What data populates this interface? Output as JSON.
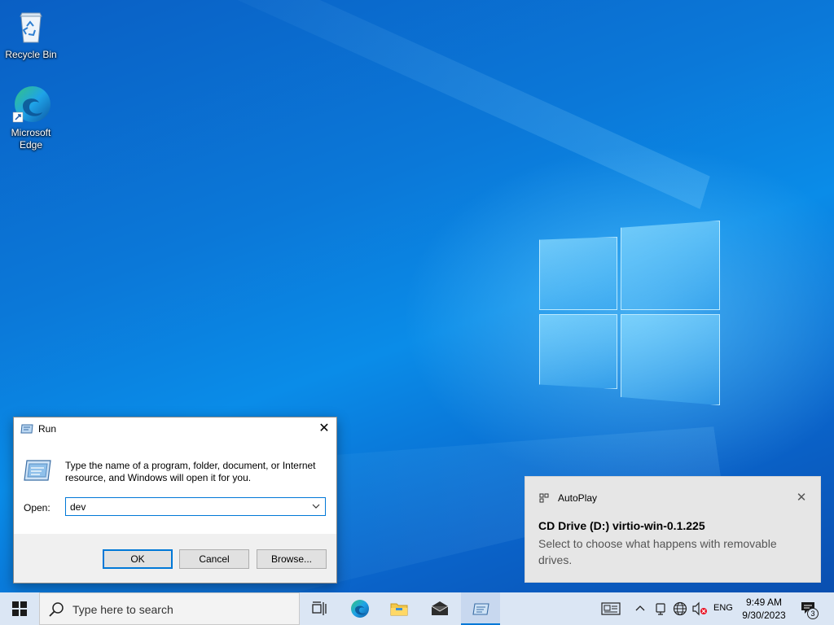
{
  "desktop": {
    "icons": [
      {
        "label": "Recycle Bin"
      },
      {
        "label": "Microsoft Edge"
      }
    ]
  },
  "run_dialog": {
    "title": "Run",
    "description": "Type the name of a program, folder, document, or Internet resource, and Windows will open it for you.",
    "open_label": "Open:",
    "input_value": "dev",
    "ok_label": "OK",
    "cancel_label": "Cancel",
    "browse_label": "Browse..."
  },
  "toast": {
    "app_name": "AutoPlay",
    "title": "CD Drive (D:) virtio-win-0.1.225",
    "body": "Select to choose what happens with removable drives."
  },
  "taskbar": {
    "search_placeholder": "Type here to search",
    "language": "ENG",
    "time": "9:49 AM",
    "date": "9/30/2023",
    "notification_count": "3"
  },
  "colors": {
    "accent": "#0078d7",
    "desktop_blue": "#0a78d8",
    "taskbar": "#dbe6f4"
  }
}
